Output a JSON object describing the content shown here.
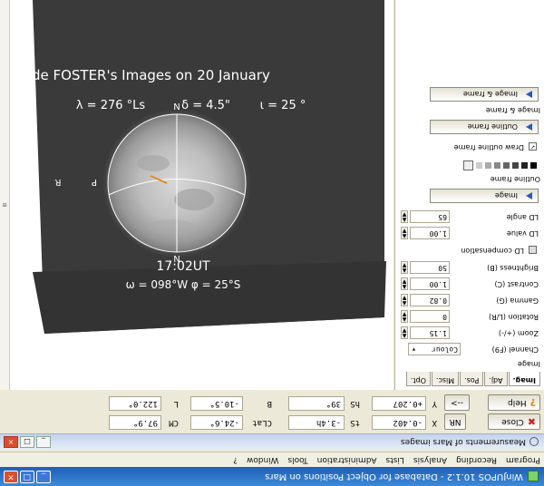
{
  "app": {
    "title": "WinJUPOS 10.1.2 - Database for Object Positions on Mars",
    "menu": [
      "Program",
      "Recording",
      "Analysis",
      "Lists",
      "Administration",
      "Tools",
      "Window",
      "?"
    ]
  },
  "window": {
    "title": "Measurements of Mars images"
  },
  "tabs": [
    "Imag.",
    "Adj.",
    "Pos.",
    "Misc.",
    "Opt."
  ],
  "controls": {
    "close_label": "Close",
    "help_label": "Help",
    "nr_label": "NR",
    "arrow_label": "-->",
    "row1": [
      {
        "label": "X",
        "value": "-0.402"
      },
      {
        "label": "tS",
        "value": "-3.4h"
      },
      {
        "label": "CLat",
        "value": "-24.6°"
      },
      {
        "label": "CM",
        "value": "97.9°"
      }
    ],
    "row2": [
      {
        "label": "Y",
        "value": "+0.207"
      },
      {
        "label": "hS",
        "value": "39°"
      },
      {
        "label": "B",
        "value": "-10.5°"
      },
      {
        "label": "L",
        "value": "122.0°"
      }
    ]
  },
  "panel": {
    "image_group": "Image",
    "channel_label": "Channel (F9)",
    "channel_value": "Colour",
    "zoom_label": "Zoom (+/-)",
    "zoom_value": "1.15",
    "rotation_label": "Rotation (L/R)",
    "rotation_value": "0",
    "gamma_label": "Gamma (G)",
    "gamma_value": "0.82",
    "contrast_label": "Contrast (C)",
    "contrast_value": "1.00",
    "brightness_label": "Brightness (B)",
    "brightness_value": "50",
    "ld_comp_label": "LD compensation",
    "ld_value_label": "LD value",
    "ld_value": "1.00",
    "ld_angle_label": "LD angle",
    "ld_angle": "65",
    "image_button": "Image",
    "outline_group": "Outline frame",
    "draw_outline_label": "Draw outline frame",
    "outline_button": "Outline frame",
    "imgframe_group": "Image & frame",
    "imgframe_button": "Image & frame"
  },
  "mars_image": {
    "title": "yde FOSTER's Images on 20 January",
    "params": [
      "λ = 276 °Ls",
      "δ = 4.5\"",
      "ι = 25 °"
    ],
    "time": "17:02UT",
    "omega": "ω = 098°W   φ = 25°S",
    "north_label": "N",
    "p_label": "P",
    "r_label": "R",
    "n_label_bottom": "N"
  },
  "colors": {
    "titlebar": "#1f5fb8",
    "accent_blue": "#2c57b8",
    "image_bg": "#3a3a3a"
  }
}
